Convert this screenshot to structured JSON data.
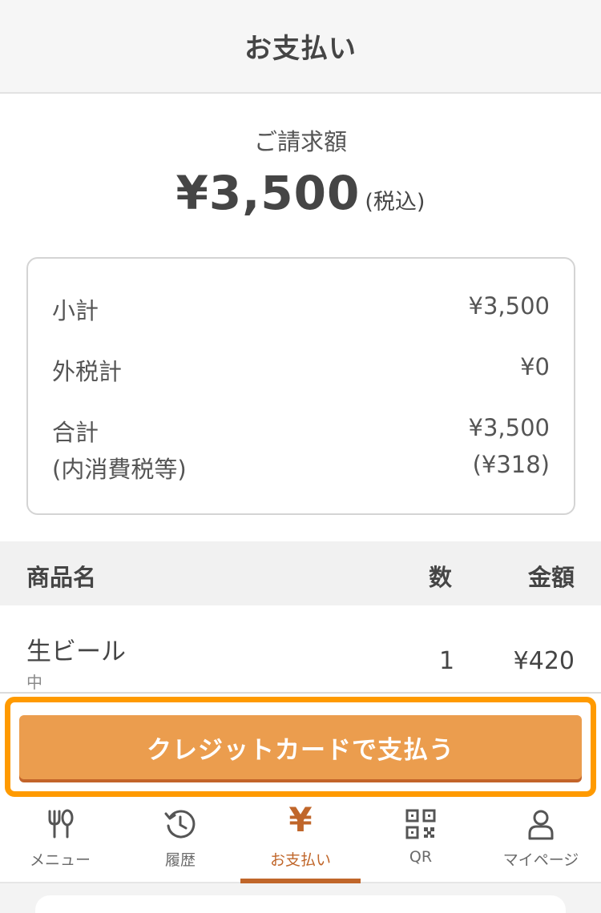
{
  "header": {
    "title": "お支払い"
  },
  "billing": {
    "label": "ご請求額",
    "amount": "¥3,500",
    "tax_note": "(税込)"
  },
  "summary": {
    "subtotal_label": "小計",
    "subtotal_value": "¥3,500",
    "external_tax_label": "外税計",
    "external_tax_value": "¥0",
    "total_label": "合計",
    "total_value": "¥3,500",
    "included_tax_label": "(内消費税等)",
    "included_tax_value": "(¥318)"
  },
  "table": {
    "headers": {
      "name": "商品名",
      "qty": "数",
      "price": "金額"
    },
    "items": [
      {
        "name": "生ビール",
        "option": "中",
        "qty": "1",
        "price": "¥420"
      }
    ]
  },
  "pay_button": {
    "label": "クレジットカードで支払う"
  },
  "tabs": [
    {
      "label": "メニュー",
      "icon": "fork-knife-icon"
    },
    {
      "label": "履歴",
      "icon": "history-icon"
    },
    {
      "label": "お支払い",
      "icon": "yen-icon",
      "active": true
    },
    {
      "label": "QR",
      "icon": "qr-code-icon"
    },
    {
      "label": "マイページ",
      "icon": "person-icon"
    }
  ],
  "colors": {
    "accent": "#c0662a",
    "button": "#eb9d4e",
    "highlight": "#ff9a00"
  }
}
